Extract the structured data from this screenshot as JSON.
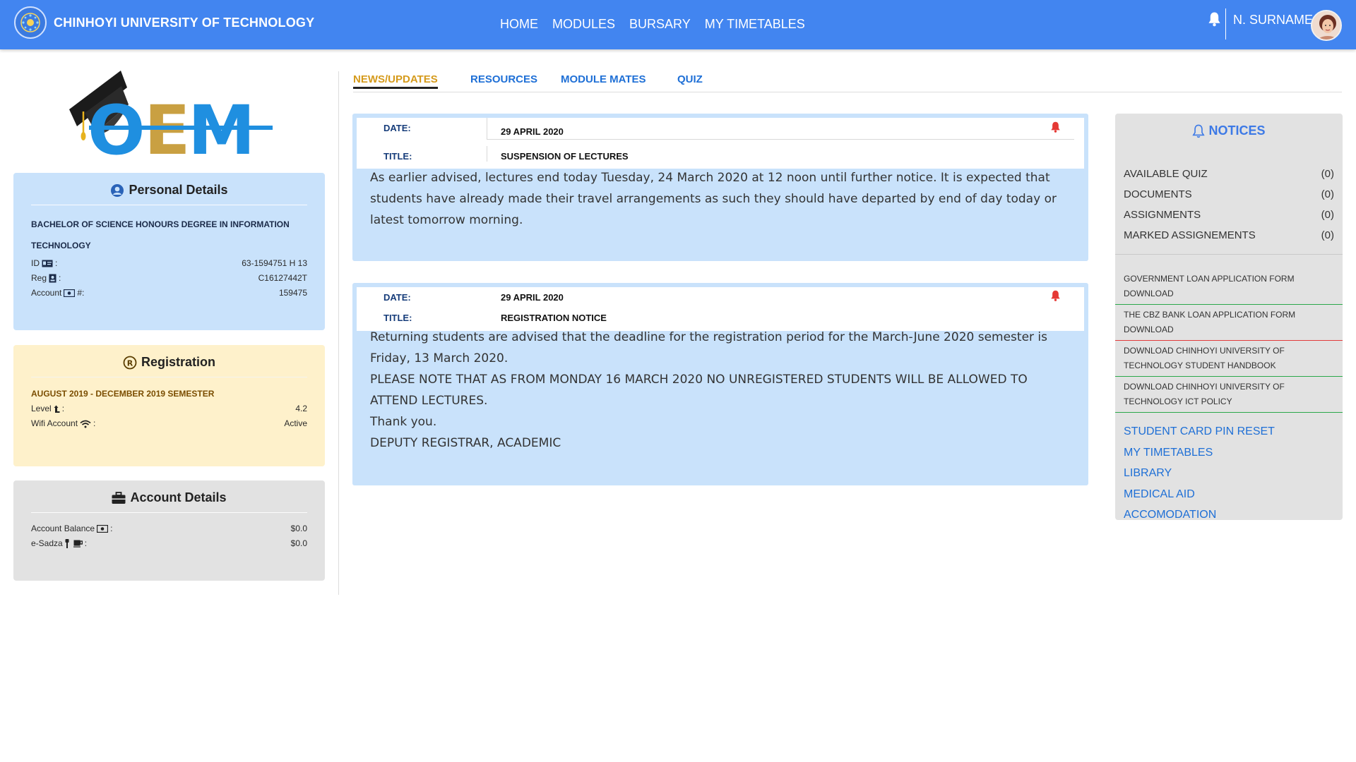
{
  "header": {
    "university_name": "CHINHOYI UNIVERSITY OF TECHNOLOGY",
    "nav": [
      "HOME",
      "MODULES",
      "BURSARY",
      "MY TIMETABLES"
    ],
    "username": "N. SURNAME"
  },
  "logo_text": "OEM",
  "personal": {
    "title": "Personal Details",
    "program": "BACHELOR OF SCIENCE HONOURS DEGREE IN INFORMATION TECHNOLOGY",
    "id_label": "ID",
    "id_value": "63-1594751 H 13",
    "reg_label": "Reg",
    "reg_value": "C16127442T",
    "account_label": "Account",
    "account_suffix": "#:",
    "account_value": "159475"
  },
  "registration": {
    "title": "Registration",
    "semester": "AUGUST 2019 - DECEMBER 2019 SEMESTER",
    "level_label": "Level",
    "level_value": "4.2",
    "wifi_label": "Wifi Account",
    "wifi_value": "Active"
  },
  "account": {
    "title": "Account Details",
    "balance_label": "Account Balance",
    "balance_value": "$0.0",
    "esadza_label": "e-Sadza",
    "esadza_value": "$0.0"
  },
  "tabs": [
    "NEWS/UPDATES",
    "RESOURCES",
    "MODULE MATES",
    "QUIZ"
  ],
  "news": [
    {
      "date_label": "DATE:",
      "date": "29 APRIL 2020",
      "title_label": "TITLE:",
      "title": "SUSPENSION OF LECTURES",
      "body": [
        "As earlier advised, lectures end today Tuesday, 24 March 2020 at 12 noon until further notice. It is expected that students have already made their travel arrangements as such they should have departed by end of day today or latest tomorrow morning."
      ]
    },
    {
      "date_label": "DATE:",
      "date": "29 APRIL 2020",
      "title_label": "TITLE:",
      "title": "REGISTRATION NOTICE",
      "body": [
        "Returning students are advised that the deadline for the registration period for the March-June 2020 semester is Friday, 13 March 2020.",
        "PLEASE NOTE THAT AS FROM MONDAY 16 MARCH 2020 NO UNREGISTERED STUDENTS WILL BE ALLOWED TO ATTEND LECTURES.",
        "Thank you.",
        "DEPUTY REGISTRAR, ACADEMIC"
      ]
    }
  ],
  "notices": {
    "title": "NOTICES",
    "counts": [
      {
        "label": "AVAILABLE QUIZ",
        "value": "(0)"
      },
      {
        "label": "DOCUMENTS",
        "value": "(0)"
      },
      {
        "label": "ASSIGNMENTS",
        "value": "(0)"
      },
      {
        "label": "MARKED ASSIGNEMENTS",
        "value": "(0)"
      }
    ],
    "downloads": [
      "GOVERNMENT LOAN APPLICATION FORM DOWNLOAD",
      "THE CBZ BANK LOAN APPLICATION FORM DOWNLOAD",
      "DOWNLOAD CHINHOYI UNIVERSITY OF TECHNOLOGY STUDENT HANDBOOK",
      "DOWNLOAD CHINHOYI UNIVERSITY OF TECHNOLOGY ICT POLICY"
    ],
    "links": [
      "STUDENT CARD PIN RESET",
      "MY TIMETABLES",
      "LIBRARY",
      "MEDICAL AID",
      "ACCOMODATION"
    ]
  },
  "colors": {
    "header_blue": "#4285f0",
    "tab_active": "#d59a1b",
    "link_blue": "#1e6fd6",
    "alert_red": "#e53935"
  }
}
